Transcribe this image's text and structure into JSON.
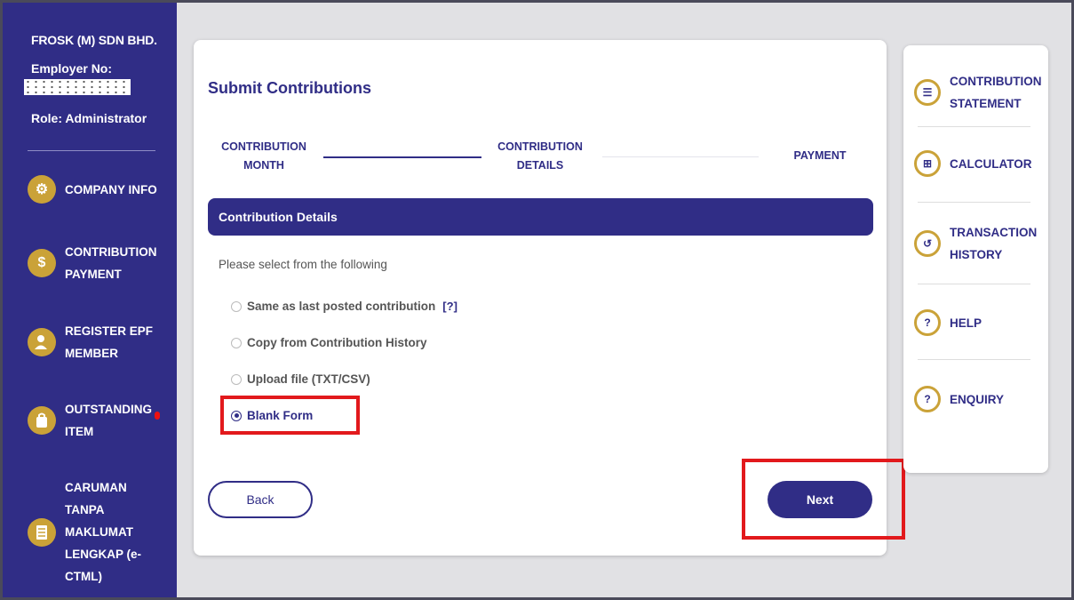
{
  "sidebar": {
    "company": "FROSK (M) SDN BHD.",
    "employer_label": "Employer No:",
    "role": "Role: Administrator",
    "items": [
      {
        "label": "COMPANY INFO",
        "icon": "gear-icon"
      },
      {
        "label": "CONTRIBUTION\nPAYMENT",
        "icon": "money-hand-icon"
      },
      {
        "label": "REGISTER EPF\nMEMBER",
        "icon": "user-register-icon"
      },
      {
        "label": "OUTSTANDING\nITEM",
        "icon": "bag-icon"
      },
      {
        "label": "CARUMAN\nTANPA\nMAKLUMAT\nLENGKAP (e-\nCTML)",
        "icon": "document-icon"
      }
    ]
  },
  "main": {
    "title": "Submit Contributions",
    "steps": [
      {
        "label": "CONTRIBUTION\nMONTH"
      },
      {
        "label": "CONTRIBUTION\nDETAILS"
      },
      {
        "label": "PAYMENT"
      }
    ],
    "section_title": "Contribution Details",
    "instruction": "Please select from the following",
    "options": [
      {
        "label": "Same as last posted contribution",
        "help": "[?]",
        "selected": false
      },
      {
        "label": "Copy from Contribution History",
        "selected": false
      },
      {
        "label": "Upload file (TXT/CSV)",
        "selected": false
      },
      {
        "label": "Blank Form",
        "selected": true
      }
    ],
    "back_label": "Back",
    "next_label": "Next"
  },
  "right_panel": {
    "items": [
      {
        "label": "CONTRIBUTION\nSTATEMENT",
        "icon": "statement-icon"
      },
      {
        "label": "CALCULATOR",
        "icon": "calculator-icon"
      },
      {
        "label": "TRANSACTION\nHISTORY",
        "icon": "history-icon"
      },
      {
        "label": "HELP",
        "icon": "help-icon"
      },
      {
        "label": "ENQUIRY",
        "icon": "enquiry-icon"
      }
    ]
  },
  "colors": {
    "primary": "#302d86",
    "accent": "#caa238",
    "highlight": "#e2191c"
  }
}
